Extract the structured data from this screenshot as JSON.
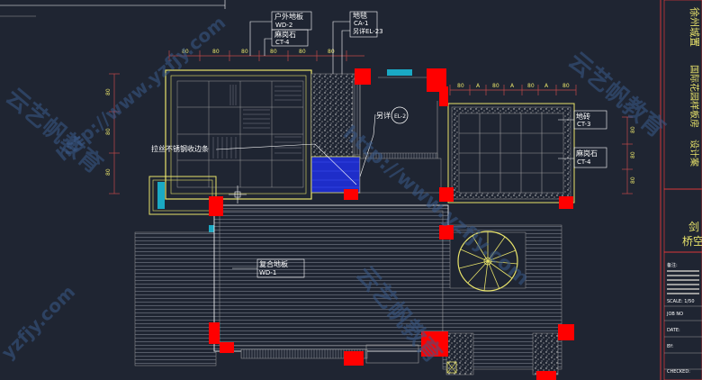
{
  "labels": {
    "outdoor_floor": "户外地板",
    "outdoor_floor_code": "WD-2",
    "granite_1": "麻岗石",
    "granite_1_code": "CT-4",
    "carpet": "地毯",
    "carpet_code": "CA-1",
    "carpet_ref": "另详EL-23",
    "other_detail": "另详",
    "other_detail_code": "EL-2",
    "steel_edge": "拉丝不锈钢收边条",
    "tile": "地砖",
    "tile_code": "CT-3",
    "granite_2": "麻岗石",
    "granite_2_code": "CT-4",
    "composite_floor": "复合地板",
    "composite_floor_code": "WD-1"
  },
  "dims": {
    "top_left": [
      "80",
      "80",
      "80",
      "80",
      "80",
      "80"
    ],
    "top_right": [
      "80",
      "A",
      "80",
      "A",
      "80",
      "A",
      "80"
    ],
    "left_side": [
      "80",
      "80",
      "80",
      "80"
    ],
    "right_side": [
      "80",
      "80",
      "80"
    ]
  },
  "title_block": {
    "project_v1": "徐州城置",
    "project_v2": "国际花园样板房",
    "project_v3": "设计案",
    "drawing_title_1": "剑",
    "drawing_title_2": "桥空",
    "notes_header": "备注:",
    "scale": "SCALE: 1/50",
    "job_no": "JOB NO",
    "date": "DATE:",
    "by": "BY:",
    "checked": "CHECKED:"
  },
  "watermarks": [
    "云艺帆教育",
    "http://www.yzfjy.com",
    "云艺帆教育",
    "http://www.yzfjy.com",
    "yzfjy.com",
    "云艺帆教育"
  ]
}
